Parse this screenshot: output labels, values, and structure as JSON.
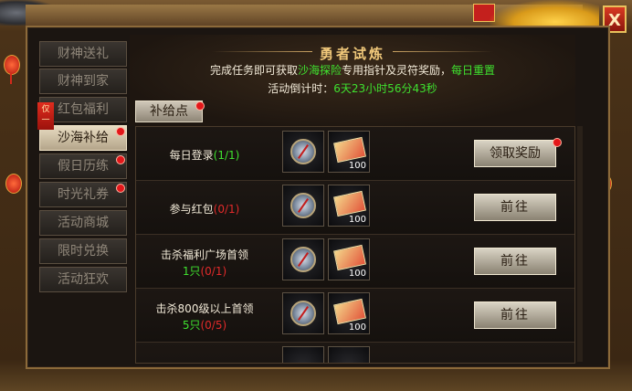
{
  "window": {
    "close_label": "X"
  },
  "sidebar": {
    "ribbon_label": "仅\n一",
    "items": [
      {
        "label": "财神送礼",
        "active": false,
        "dot": false
      },
      {
        "label": "财神到家",
        "active": false,
        "dot": false
      },
      {
        "label": "红包福利",
        "active": false,
        "dot": false
      },
      {
        "label": "沙海补给",
        "active": true,
        "dot": true
      },
      {
        "label": "假日历练",
        "active": false,
        "dot": true
      },
      {
        "label": "时光礼券",
        "active": false,
        "dot": true
      },
      {
        "label": "活动商城",
        "active": false,
        "dot": false
      },
      {
        "label": "限时兑换",
        "active": false,
        "dot": false
      },
      {
        "label": "活动狂欢",
        "active": false,
        "dot": false
      }
    ]
  },
  "banner": {
    "title": "勇者试炼",
    "desc_prefix": "完成任务即可获取",
    "desc_highlight": "沙海探险",
    "desc_middle": "专用指针及灵符奖励，",
    "desc_reset": "每日重置",
    "countdown_label": "活动倒计时：",
    "countdown_value": "6天23小时56分43秒"
  },
  "supply_button": {
    "label": "补给点"
  },
  "tasks": [
    {
      "name": "每日登录",
      "progress": "(1/1)",
      "progress_done": true,
      "sub": "",
      "sub_progress": "",
      "items": [
        {
          "icon": "compass-icon",
          "qty": ""
        },
        {
          "icon": "talisman-icon",
          "qty": "100"
        }
      ],
      "button": "领取奖励",
      "button_dot": true
    },
    {
      "name": "参与红包",
      "progress": "(0/1)",
      "progress_done": false,
      "sub": "",
      "sub_progress": "",
      "items": [
        {
          "icon": "compass-icon",
          "qty": ""
        },
        {
          "icon": "talisman-icon",
          "qty": "100"
        }
      ],
      "button": "前往",
      "button_dot": false
    },
    {
      "name": "击杀福利广场首领",
      "progress": "",
      "progress_done": false,
      "sub": "1只",
      "sub_progress": "(0/1)",
      "items": [
        {
          "icon": "compass-icon",
          "qty": ""
        },
        {
          "icon": "talisman-icon",
          "qty": "100"
        }
      ],
      "button": "前往",
      "button_dot": false
    },
    {
      "name": "击杀800级以上首领",
      "progress": "",
      "progress_done": false,
      "sub": "5只",
      "sub_progress": "(0/5)",
      "items": [
        {
          "icon": "compass-icon",
          "qty": ""
        },
        {
          "icon": "talisman-icon",
          "qty": "100"
        }
      ],
      "button": "前往",
      "button_dot": false
    }
  ]
}
